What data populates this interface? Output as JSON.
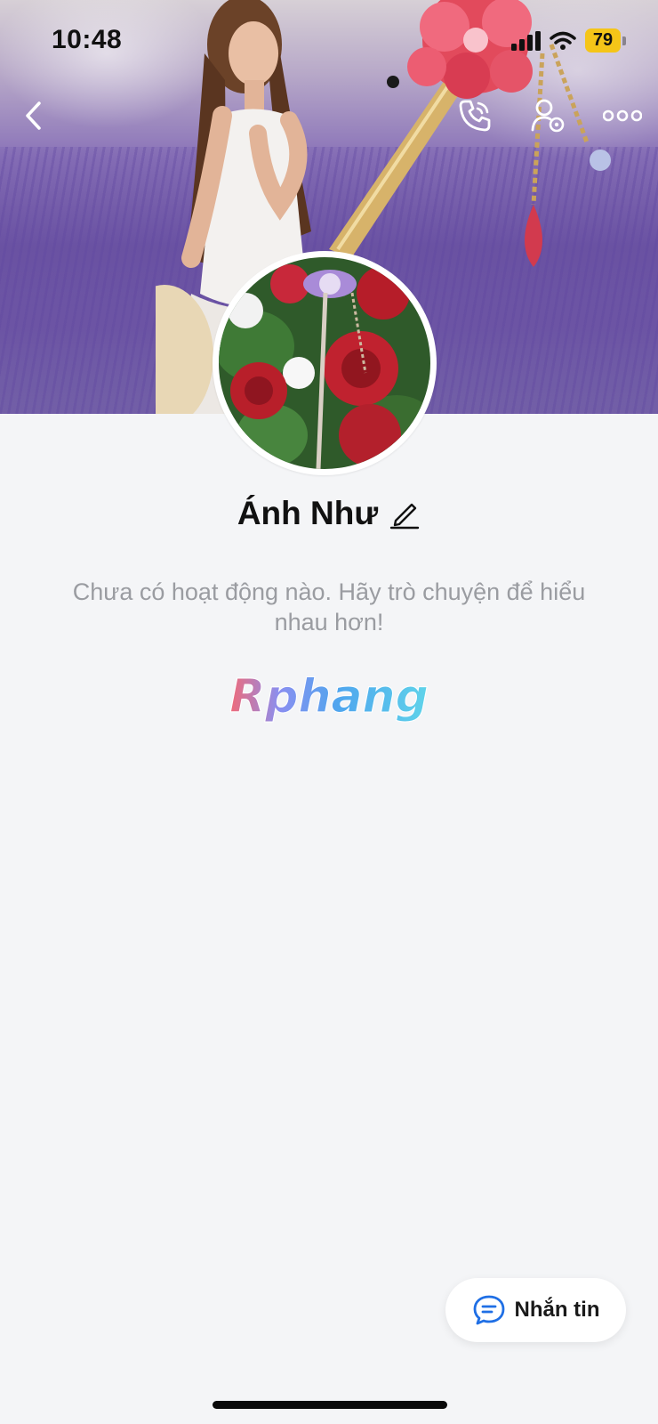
{
  "status_bar": {
    "time": "10:48",
    "battery": "79",
    "icons": [
      "cellular-signal-icon",
      "wifi-icon",
      "battery-icon"
    ]
  },
  "nav": {
    "icons": [
      "back-chevron-icon",
      "phone-call-icon",
      "user-settings-icon",
      "more-options-icon"
    ]
  },
  "profile": {
    "name": "Ánh Như",
    "edit_icon": "pencil-icon"
  },
  "empty_state": {
    "message": "Chưa có hoạt động nào. Hãy trò chuyện để hiểu nhau hơn!"
  },
  "watermark": {
    "text": "Rphang"
  },
  "message_button": {
    "label": "Nhắn tin",
    "icon": "chat-bubble-icon"
  },
  "colors": {
    "accent": "#1f6fe5",
    "background": "#f4f5f7",
    "battery": "#f5c518"
  }
}
